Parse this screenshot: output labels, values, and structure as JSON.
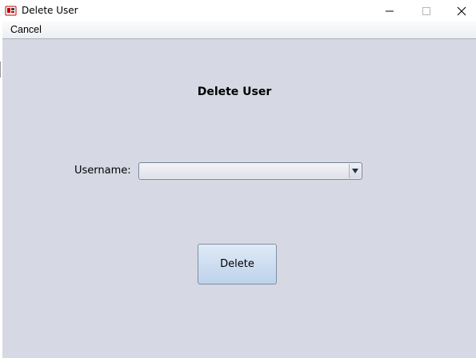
{
  "window": {
    "title": "Delete User",
    "app_icon": "java-app-icon",
    "controls": [
      "minimize-icon",
      "maximize-icon",
      "close-icon"
    ]
  },
  "menu": {
    "items": [
      {
        "label": "Cancel"
      }
    ]
  },
  "form": {
    "heading": "Delete User",
    "username_label": "Username:",
    "username_value": "",
    "delete_label": "Delete"
  },
  "colors": {
    "panel_background": "#d6d9e3",
    "button_gradient_top": "#dfeaf8",
    "button_gradient_bottom": "#bed2ea"
  }
}
